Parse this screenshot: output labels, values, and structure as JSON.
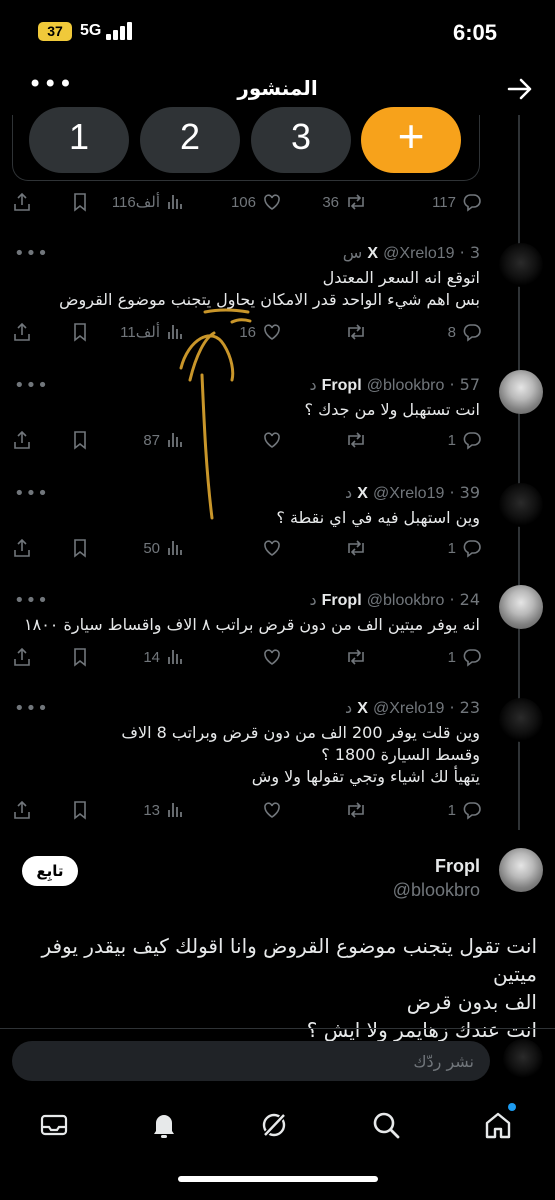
{
  "status_bar": {
    "time": "6:05",
    "battery": "37",
    "network": "5G"
  },
  "header": {
    "title": "المنشور",
    "more": "•••"
  },
  "poll": {
    "options": [
      "1",
      "2",
      "3",
      "+"
    ]
  },
  "top_actions": {
    "replies": "117",
    "reposts": "36",
    "likes": "106",
    "views": "116ألف"
  },
  "tweets": [
    {
      "name": "X",
      "handle": "@Xrelo19",
      "time": "· 3 س",
      "avatar": "x",
      "lines": [
        "اتوقع انه السعر المعتدل",
        "بس اهم شيء الواحد قدر الامكان يحاول يتجنب موضوع القروض"
      ],
      "replies": "8",
      "reposts": "",
      "likes": "16",
      "views": "11ألف"
    },
    {
      "name": "Fropl",
      "handle": "@blookbro",
      "time": "· 57 د",
      "avatar": "f",
      "lines": [
        "انت تستهبل ولا من جدك ؟"
      ],
      "replies": "1",
      "reposts": "",
      "likes": "",
      "views": "87"
    },
    {
      "name": "X",
      "handle": "@Xrelo19",
      "time": "· 39 د",
      "avatar": "x",
      "lines": [
        "وين استهبل فيه في اي نقطة ؟"
      ],
      "replies": "1",
      "reposts": "",
      "likes": "",
      "views": "50"
    },
    {
      "name": "Fropl",
      "handle": "@blookbro",
      "time": "· 24 د",
      "avatar": "f",
      "lines": [
        "انه يوفر ميتين الف من دون قرض براتب ٨ الاف واقساط سيارة ١٨٠٠"
      ],
      "replies": "1",
      "reposts": "",
      "likes": "",
      "views": "14"
    },
    {
      "name": "X",
      "handle": "@Xrelo19",
      "time": "· 23 د",
      "avatar": "x",
      "lines": [
        "وين قلت يوفر 200 الف من دون قرض وبراتب 8 الاف",
        "وقسط السيارة 1800 ؟",
        "يتهيأ لك اشياء وتجي تقولها ولا وش"
      ],
      "replies": "1",
      "reposts": "",
      "likes": "",
      "views": "13"
    }
  ],
  "focused": {
    "name": "Fropl",
    "handle": "@blookbro",
    "follow_label": "تابِع",
    "lines": [
      "انت تقول يتجنب موضوع القروض وانا اقولك كيف بيقدر يوفر ميتين",
      "الف بدون قرض",
      "انت عندك زهايمر ولا ايش ؟"
    ]
  },
  "reply": {
    "placeholder": "نشر ردّك"
  },
  "colors": {
    "background": "#000000",
    "accent": "#1d9bf0",
    "poll_add": "#f7a21b",
    "annotation": "#c9962a",
    "muted": "#71767b"
  }
}
